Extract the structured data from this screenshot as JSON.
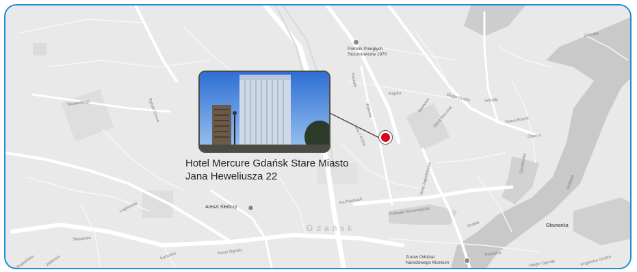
{
  "hotel": {
    "name": "Hotel Mercure Gdańsk Stare Miasto",
    "address": "Jana Heweliusza 22"
  },
  "map": {
    "city_label": "Gdańsk",
    "poi_labels": {
      "monument": "Pomnik Poległych\nStoczniowców 1970",
      "detention": "Areszt Śledczy",
      "museum": "Zurow Oddział\nNarodowego Muzeum",
      "island": "Ołowianka"
    },
    "street_labels": {
      "s1": "Słowackiego",
      "s2": "Kartuska",
      "s3": "Nowe Ogrody",
      "s4": "Podwale Staromiejskie",
      "s5": "Na Piaskach",
      "s6": "Grobla",
      "s7": "Długie Ogrody",
      "s8": "Jaśkowa",
      "s9": "Zakopiańska",
      "s10": "Skarpowa",
      "s11": "Łagiewniki",
      "s12": "Rybaki Górne",
      "s13": "Wałowa",
      "s14": "Jana z Kolna",
      "s15": "Mostowa",
      "s16": "Długa Grobla",
      "s17": "Motława",
      "s18": "Angielska Grobla",
      "s19": "Toruńska",
      "s20": "Hucisko",
      "s21": "Rajska",
      "s22": "Stara Stocznia",
      "s23": "Sobótki",
      "s24": "Dolna Brama",
      "s25": "Wały Jagiellońskie",
      "s26": "Chlebnicka",
      "s27": "Ogarna",
      "s28": "Szeroka"
    }
  },
  "colors": {
    "frame_border": "#1a8fd8",
    "pin": "#e3001b",
    "water": "#c9c9c9",
    "land": "#e9e9e9"
  }
}
